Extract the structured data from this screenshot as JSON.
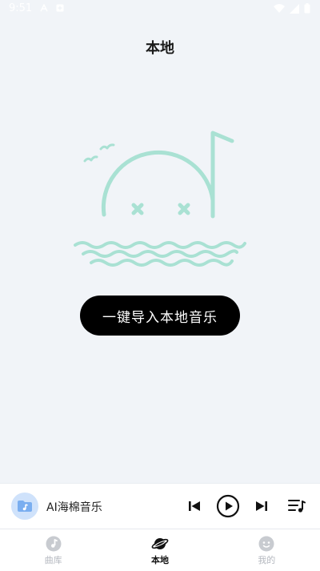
{
  "status_bar": {
    "time": "9:51",
    "icons": [
      "notification-a-icon",
      "plus-square-icon",
      "wifi-icon",
      "signal-icon",
      "battery-icon"
    ]
  },
  "header": {
    "title": "本地"
  },
  "empty_state": {
    "illustration": "sad-music-note-in-water-icon",
    "accent_color": "#a9e1d3"
  },
  "import_button": {
    "label": "一键导入本地音乐"
  },
  "player": {
    "title": "AI海棉音乐",
    "cover_icon": "folder-music-icon",
    "controls": [
      "previous-icon",
      "play-icon",
      "next-icon",
      "playlist-icon"
    ]
  },
  "tabs": [
    {
      "label": "曲库",
      "icon": "music-disc-icon",
      "active": false
    },
    {
      "label": "本地",
      "icon": "planet-icon",
      "active": true
    },
    {
      "label": "我的",
      "icon": "face-icon",
      "active": false
    }
  ],
  "colors": {
    "background": "#f1f4f8",
    "button": "#000000",
    "active_tab": "#111111",
    "inactive_tab": "#b4b8bf"
  }
}
